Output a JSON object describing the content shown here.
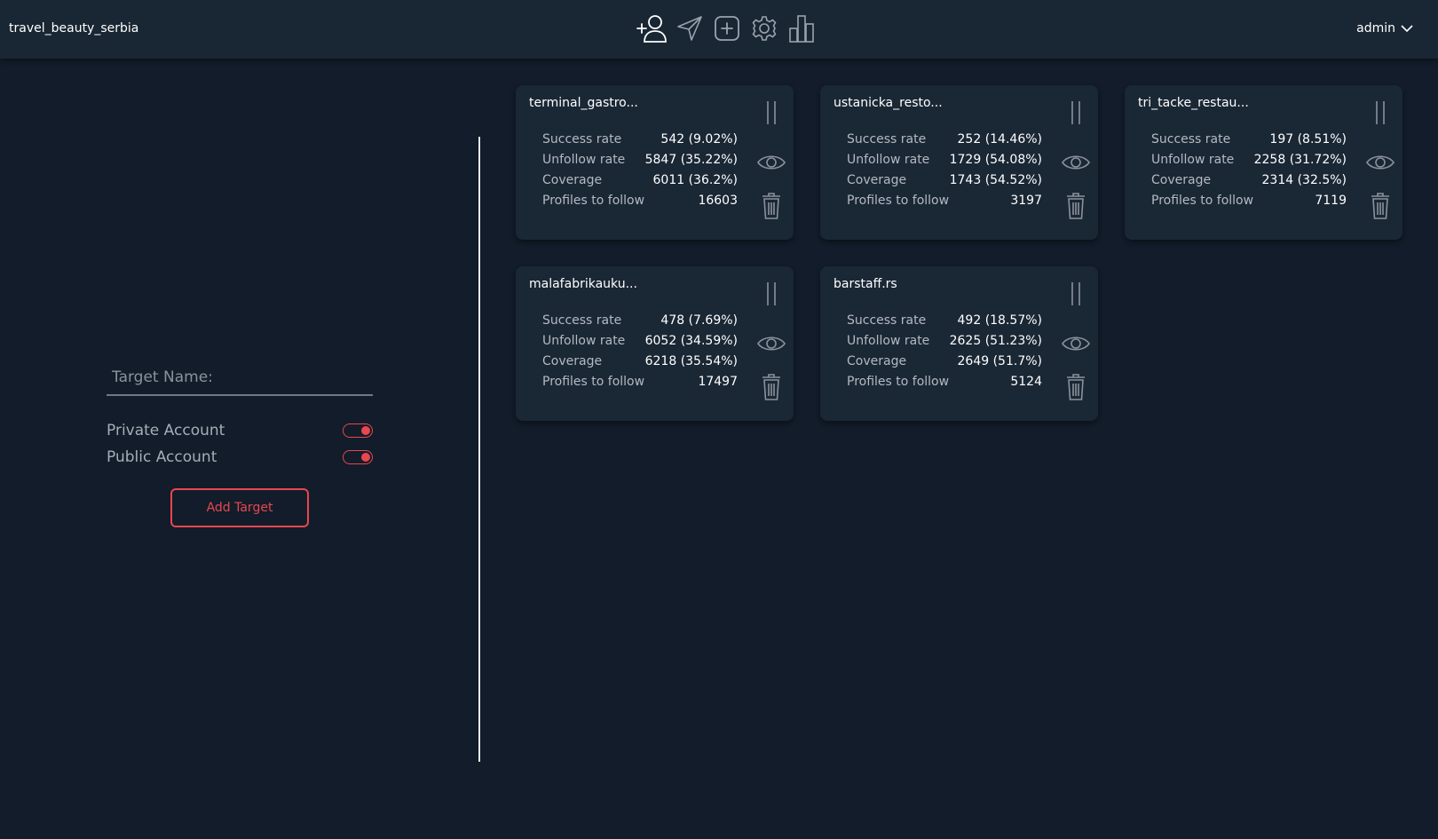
{
  "header": {
    "account_name": "travel_beauty_serbia",
    "user": "admin"
  },
  "nav_icons": [
    "add-user-icon",
    "send-icon",
    "plus-square-icon",
    "gear-icon",
    "bar-chart-icon"
  ],
  "form": {
    "target_placeholder": "Target Name:",
    "private_label": "Private Account",
    "public_label": "Public Account",
    "private_enabled": true,
    "public_enabled": true,
    "add_label": "Add Target"
  },
  "stat_labels": {
    "success": "Success rate",
    "unfollow": "Unfollow rate",
    "coverage": "Coverage",
    "profiles": "Profiles to follow"
  },
  "targets": [
    {
      "name": "terminal_gastro...",
      "success": "542 (9.02%)",
      "unfollow": "5847 (35.22%)",
      "coverage": "6011 (36.2%)",
      "profiles": "16603"
    },
    {
      "name": "ustanicka_resto...",
      "success": "252 (14.46%)",
      "unfollow": "1729 (54.08%)",
      "coverage": "1743 (54.52%)",
      "profiles": "3197"
    },
    {
      "name": "tri_tacke_restau...",
      "success": "197 (8.51%)",
      "unfollow": "2258 (31.72%)",
      "coverage": "2314 (32.5%)",
      "profiles": "7119"
    },
    {
      "name": "malafabrikauku...",
      "success": "478 (7.69%)",
      "unfollow": "6052 (34.59%)",
      "coverage": "6218 (35.54%)",
      "profiles": "17497"
    },
    {
      "name": "barstaff.rs",
      "success": "492 (18.57%)",
      "unfollow": "2625 (51.23%)",
      "coverage": "2649 (51.7%)",
      "profiles": "5124"
    }
  ],
  "colors": {
    "accent": "#e8474f",
    "background": "#121c2a",
    "card": "#1a2735",
    "header": "#192633"
  }
}
